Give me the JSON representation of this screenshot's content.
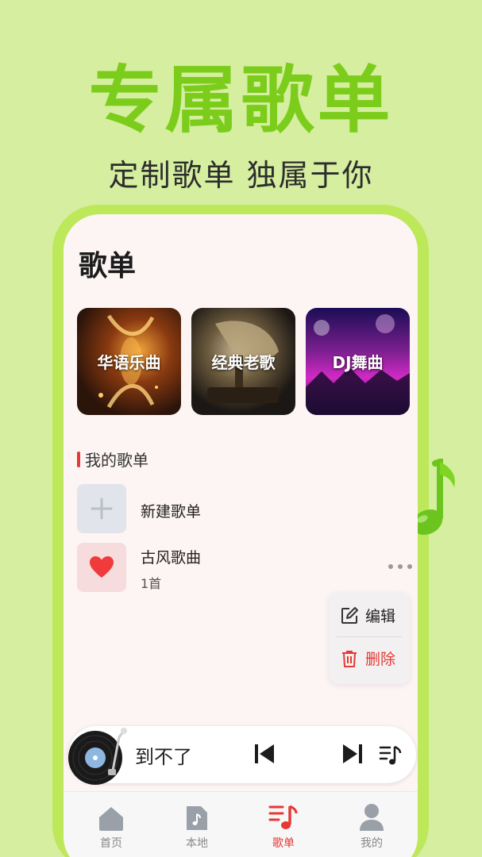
{
  "promo": {
    "title": "专属歌单",
    "subtitle": "定制歌单 独属于你"
  },
  "page": {
    "title": "歌单"
  },
  "featured": [
    {
      "label": "华语乐曲"
    },
    {
      "label": "经典老歌"
    },
    {
      "label": "DJ舞曲"
    }
  ],
  "my_playlists": {
    "heading": "我的歌单",
    "new_label": "新建歌单",
    "items": [
      {
        "name": "古风歌曲",
        "count": "1首"
      }
    ]
  },
  "context_menu": {
    "edit_label": "编辑",
    "delete_label": "删除"
  },
  "player": {
    "song_title": "到不了"
  },
  "tabs": [
    {
      "label": "首页",
      "icon": "home-icon"
    },
    {
      "label": "本地",
      "icon": "local-file-icon"
    },
    {
      "label": "歌单",
      "icon": "playlist-icon",
      "active": true
    },
    {
      "label": "我的",
      "icon": "profile-icon"
    }
  ],
  "colors": {
    "background": "#d5ee9f",
    "accent_green": "#7ccd1b",
    "phone_frame": "#bde85a",
    "active_red": "#e53935"
  }
}
